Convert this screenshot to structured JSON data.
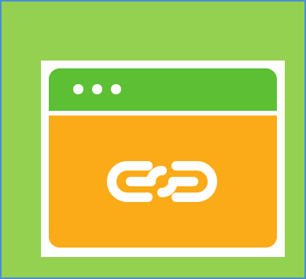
{
  "icon": {
    "name": "browser-link-icon",
    "colors": {
      "background": "#94d150",
      "border": "#4a8fd4",
      "card": "#ffffff",
      "titlebar": "#5cbf34",
      "window_body": "#fbab17",
      "glyph": "#ffffff"
    },
    "window_dots": 3
  }
}
